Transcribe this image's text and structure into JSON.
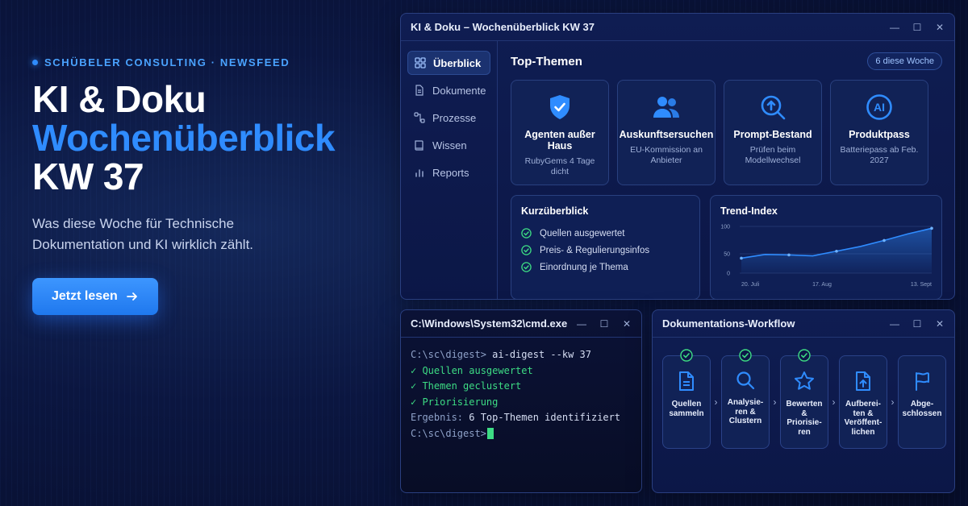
{
  "hero": {
    "kicker": "SCHÜBELER CONSULTING · NEWSFEED",
    "title_line1": "KI & Doku",
    "title_line2": "Wochenüberblick",
    "title_line3": "KW 37",
    "subtitle": "Was diese Woche für Technische Dokumentation und KI wirklich zählt.",
    "cta_label": "Jetzt lesen",
    "cta_icon": "arrow-right-icon"
  },
  "colors": {
    "accent": "#2f8cff",
    "success": "#3ddc84",
    "background": "#0b1640"
  },
  "main_window": {
    "title": "KI & Doku – Wochenüberblick KW 37",
    "sidebar": [
      {
        "label": "Überblick",
        "icon": "grid-icon",
        "active": true
      },
      {
        "label": "Dokumente",
        "icon": "document-icon",
        "active": false
      },
      {
        "label": "Prozesse",
        "icon": "process-icon",
        "active": false
      },
      {
        "label": "Wissen",
        "icon": "book-icon",
        "active": false
      },
      {
        "label": "Reports",
        "icon": "bar-chart-icon",
        "active": false
      }
    ],
    "section_title": "Top-Themen",
    "badge": "6 diese Woche",
    "cards": [
      {
        "icon": "shield-check-icon",
        "title": "Agenten außer Haus",
        "subtitle": "RubyGems 4 Tage dicht"
      },
      {
        "icon": "users-icon",
        "title": "Auskunftsersuchen",
        "subtitle": "EU-Kommission an Anbieter"
      },
      {
        "icon": "search-upload-icon",
        "title": "Prompt-Bestand",
        "subtitle": "Prüfen beim Modellwechsel"
      },
      {
        "icon": "ai-icon",
        "title": "Produktpass",
        "subtitle": "Batteriepass ab Feb. 2027"
      }
    ],
    "summary": {
      "title": "Kurzüberblick",
      "items": [
        "Quellen ausgewertet",
        "Preis- & Regulierungsinfos",
        "Einordnung je Thema"
      ]
    },
    "trend": {
      "title": "Trend-Index",
      "y_ticks": [
        "100",
        "50",
        "0"
      ],
      "x_ticks": [
        "20. Juli",
        "17. Aug",
        "13. Sept"
      ]
    }
  },
  "chart_data": {
    "type": "area",
    "title": "Trend-Index",
    "x": [
      "20. Juli",
      "27. Juli",
      "3. Aug",
      "10. Aug",
      "17. Aug",
      "24. Aug",
      "31. Aug",
      "7. Sept",
      "13. Sept"
    ],
    "values": [
      32,
      40,
      39,
      37,
      47,
      57,
      70,
      84,
      96
    ],
    "ylim": [
      0,
      100
    ],
    "xlabel": "",
    "ylabel": "",
    "grid": true
  },
  "terminal": {
    "title": "C:\\Windows\\System32\\cmd.exe",
    "prompt": "C:\\sc\\digest>",
    "command": " ai-digest --kw 37",
    "ok_lines": [
      "✓ Quellen ausgewertet",
      "✓ Themen geclustert",
      "✓ Priorisierung"
    ],
    "result_label": "Ergebnis:",
    "result_value": " 6 Top-Themen identifiziert"
  },
  "workflow": {
    "title": "Dokumentations-Workflow",
    "steps": [
      {
        "label": "Quellen\nsammeln",
        "icon": "document-icon",
        "done": true
      },
      {
        "label": "Analysie-\nren &\nClustern",
        "icon": "search-icon",
        "done": true
      },
      {
        "label": "Bewerten\n&\nPriorisie-\nren",
        "icon": "star-icon",
        "done": true
      },
      {
        "label": "Aufberei-\nten &\nVeröffent-\nlichen",
        "icon": "upload-file-icon",
        "done": false
      },
      {
        "label": "Abge-\nschlossen",
        "icon": "flag-icon",
        "done": false
      }
    ]
  },
  "window_controls": {
    "minimize": "—",
    "maximize": "☐",
    "close": "✕"
  }
}
